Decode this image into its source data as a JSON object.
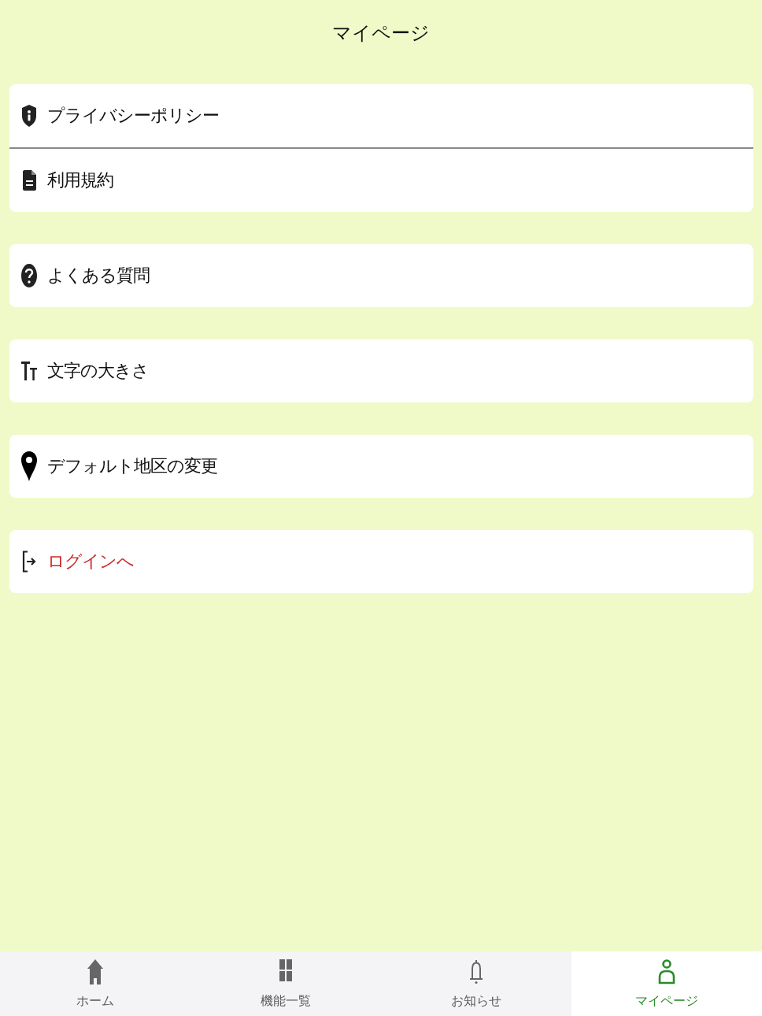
{
  "header": {
    "title": "マイページ"
  },
  "menu_groups": [
    {
      "items": [
        {
          "kind": "privacy",
          "label": "プライバシーポリシー"
        },
        {
          "kind": "terms",
          "label": "利用規約"
        }
      ]
    },
    {
      "items": [
        {
          "kind": "faq",
          "label": "よくある質問"
        }
      ]
    },
    {
      "items": [
        {
          "kind": "font-size",
          "label": "文字の大きさ"
        }
      ]
    },
    {
      "items": [
        {
          "kind": "location",
          "label": "デフォルト地区の変更"
        }
      ]
    },
    {
      "items": [
        {
          "kind": "login",
          "label": "ログインへ"
        }
      ]
    }
  ],
  "bottom_nav": {
    "tabs": [
      {
        "label": "ホーム",
        "selected": false
      },
      {
        "label": "機能一覧",
        "selected": false
      },
      {
        "label": "お知らせ",
        "selected": false
      },
      {
        "label": "マイページ",
        "selected": true
      }
    ]
  }
}
